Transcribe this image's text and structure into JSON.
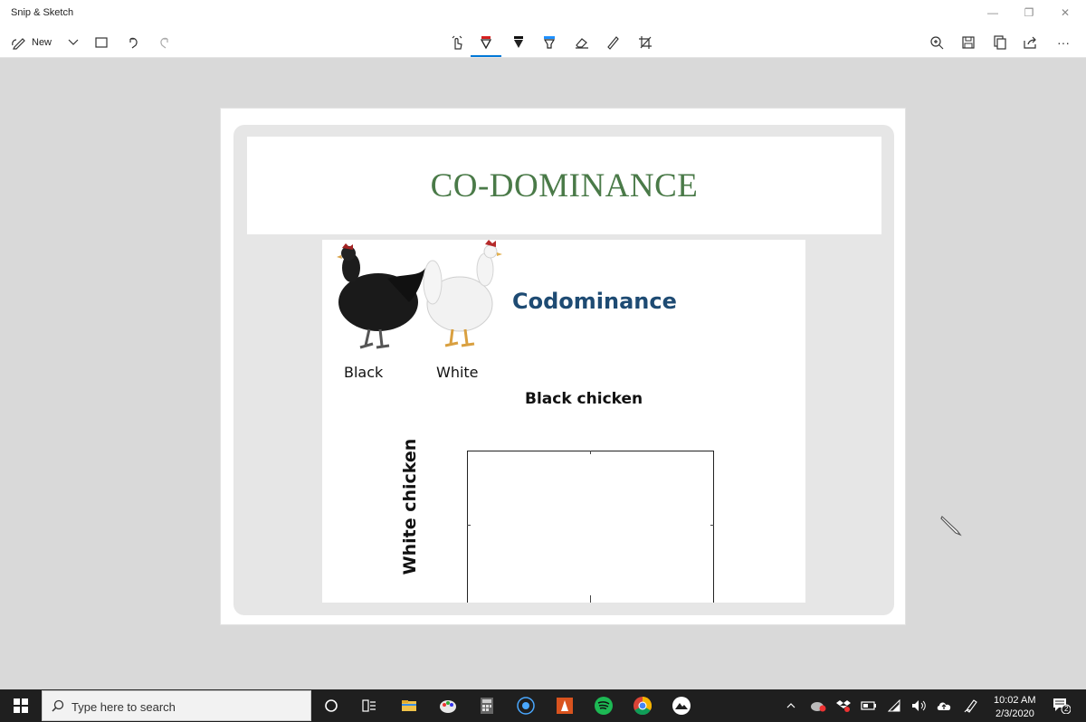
{
  "window": {
    "title": "Snip & Sketch",
    "minimize_glyph": "—",
    "restore_glyph": "❐",
    "close_glyph": "✕"
  },
  "toolbar": {
    "new_label": "New",
    "more_glyph": "···",
    "icons": {
      "new": "snip-pencil-icon",
      "new_dropdown": "chevron-down-icon",
      "open": "open-file-icon",
      "undo": "undo-icon",
      "redo": "redo-icon",
      "touch": "touch-writing-icon",
      "ballpoint": "ballpoint-pen-icon",
      "pencil": "pencil-icon",
      "highlighter": "highlighter-icon",
      "eraser": "eraser-icon",
      "ruler": "ruler-icon",
      "crop": "crop-icon",
      "zoom": "zoom-icon",
      "save": "save-icon",
      "copy": "copy-icon",
      "share": "share-icon"
    },
    "colors": {
      "ballpoint": "#d62020",
      "pencil": "#111111",
      "highlighter": "#1e90ff",
      "active_underline": "#0078d7"
    }
  },
  "slide": {
    "title": "CO-DOMINANCE",
    "heading": "Codominance",
    "black_label": "Black",
    "white_label": "White",
    "black_chicken_label": "Black chicken",
    "white_chicken_label": "White chicken",
    "title_color": "#4a7a48",
    "heading_color": "#1e4b73"
  },
  "taskbar": {
    "search_placeholder": "Type here to search",
    "time": "10:02 AM",
    "date": "2/3/2020",
    "notification_count": "2",
    "apps": [
      "cortana-icon",
      "task-view-icon",
      "file-explorer-icon",
      "paint-icon",
      "calculator-icon",
      "media-icon",
      "vlc-icon",
      "spotify-icon",
      "chrome-icon",
      "photos-icon"
    ],
    "tray": [
      "chevron-up-icon",
      "antivirus-icon",
      "dropbox-icon",
      "battery-icon",
      "wifi-icon",
      "volume-icon",
      "onedrive-icon",
      "pen-icon",
      "notification-icon"
    ]
  }
}
